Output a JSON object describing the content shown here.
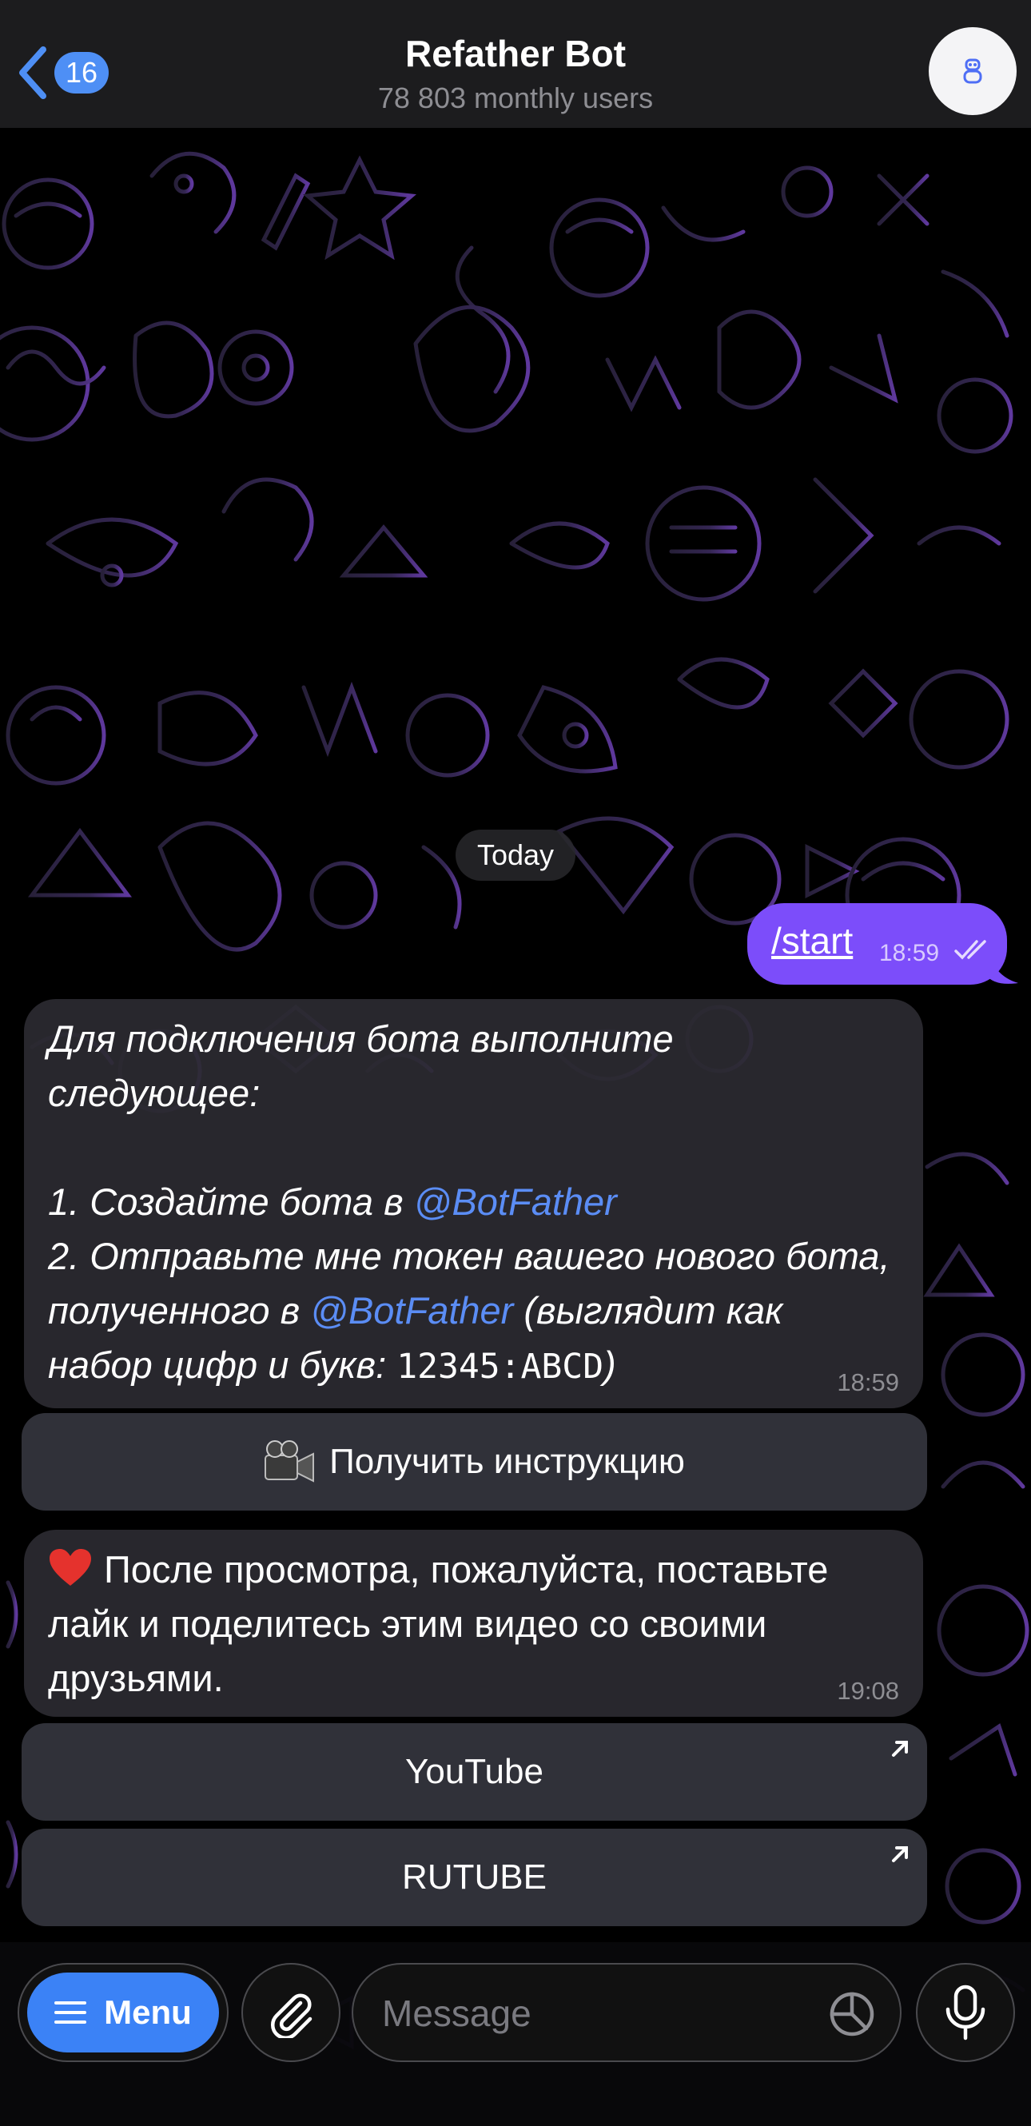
{
  "header": {
    "back_count": "16",
    "title": "Refather Bot",
    "subtitle": "78 803 monthly users"
  },
  "chat": {
    "date_label": "Today",
    "outgoing": {
      "text": "/start",
      "time": "18:59"
    },
    "message1": {
      "line1": "Для подключения бота выполните",
      "line2": "следующее:",
      "step1_prefix": "1. Создайте бота в ",
      "mention": "@BotFather",
      "step2_line1": "2. Отправьте мне токен вашего нового бота,",
      "step2_prefix": "полученного в ",
      "step2_suffix": " (выглядит как",
      "step2_line3": "набор цифр и букв: ",
      "token_example": "12345:ABCD",
      "closing": ")",
      "time": "18:59"
    },
    "button_instruction": "Получить инструкцию",
    "message2": {
      "text": "После просмотра, пожалуйста, поставьте лайк и поделитесь этим видео со своими друзьями.",
      "time": "19:08"
    },
    "button_youtube": "YouTube",
    "button_rutube": "RUTUBE"
  },
  "input_bar": {
    "menu_label": "Menu",
    "placeholder": "Message"
  },
  "colors": {
    "accent": "#3b82f6",
    "outgoing_bubble": "#7c4dfa",
    "mention": "#5b8df5"
  },
  "icons": [
    "back-chevron-icon",
    "bot-avatar-icon",
    "read-ticks-icon",
    "camera-icon",
    "heart-icon",
    "external-link-icon",
    "menu-lines-icon",
    "paperclip-icon",
    "sticker-icon",
    "microphone-icon"
  ]
}
